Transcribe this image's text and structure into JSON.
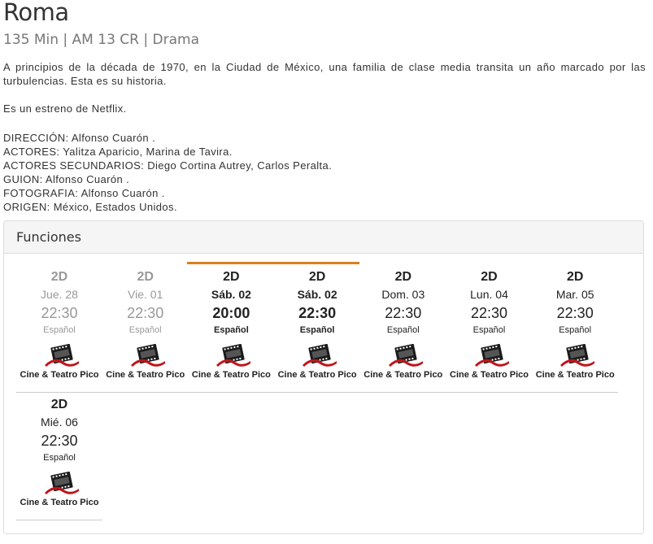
{
  "movie": {
    "title": "Roma",
    "meta": "135 Min | AM 13 CR | Drama",
    "synopsis": "A principios de la década de 1970, en la Ciudad de México, una familia de clase media transita un año marcado por las turbulencias. Esta es su historia.",
    "note": "Es un estreno de Netflix.",
    "credits": [
      "DIRECCIÓN: Alfonso Cuarón .",
      "ACTORES: Yalitza Aparicio, Marina de Tavira.",
      "ACTORES SECUNDARIOS: Diego Cortina Autrey, Carlos Peralta.",
      "GUION: Alfonso Cuarón .",
      "FOTOGRAFIA: Alfonso Cuarón .",
      "ORIGEN: México, Estados Unidos."
    ]
  },
  "functions": {
    "heading": "Funciones",
    "accent_color": "#d9821f",
    "showtimes": [
      {
        "format": "2D",
        "day": "Jue. 28",
        "time": "22:30",
        "language": "Español",
        "cinema": "Cine & Teatro Pico",
        "state": "past"
      },
      {
        "format": "2D",
        "day": "Vie. 01",
        "time": "22:30",
        "language": "Español",
        "cinema": "Cine & Teatro Pico",
        "state": "past"
      },
      {
        "format": "2D",
        "day": "Sáb. 02",
        "time": "20:00",
        "language": "Español",
        "cinema": "Cine & Teatro Pico",
        "state": "today"
      },
      {
        "format": "2D",
        "day": "Sáb. 02",
        "time": "22:30",
        "language": "Español",
        "cinema": "Cine & Teatro Pico",
        "state": "today"
      },
      {
        "format": "2D",
        "day": "Dom. 03",
        "time": "22:30",
        "language": "Español",
        "cinema": "Cine & Teatro Pico",
        "state": "normal"
      },
      {
        "format": "2D",
        "day": "Lun. 04",
        "time": "22:30",
        "language": "Español",
        "cinema": "Cine & Teatro Pico",
        "state": "normal"
      },
      {
        "format": "2D",
        "day": "Mar. 05",
        "time": "22:30",
        "language": "Español",
        "cinema": "Cine & Teatro Pico",
        "state": "normal"
      },
      {
        "format": "2D",
        "day": "Mié. 06",
        "time": "22:30",
        "language": "Español",
        "cinema": "Cine & Teatro Pico",
        "state": "normal"
      }
    ]
  }
}
